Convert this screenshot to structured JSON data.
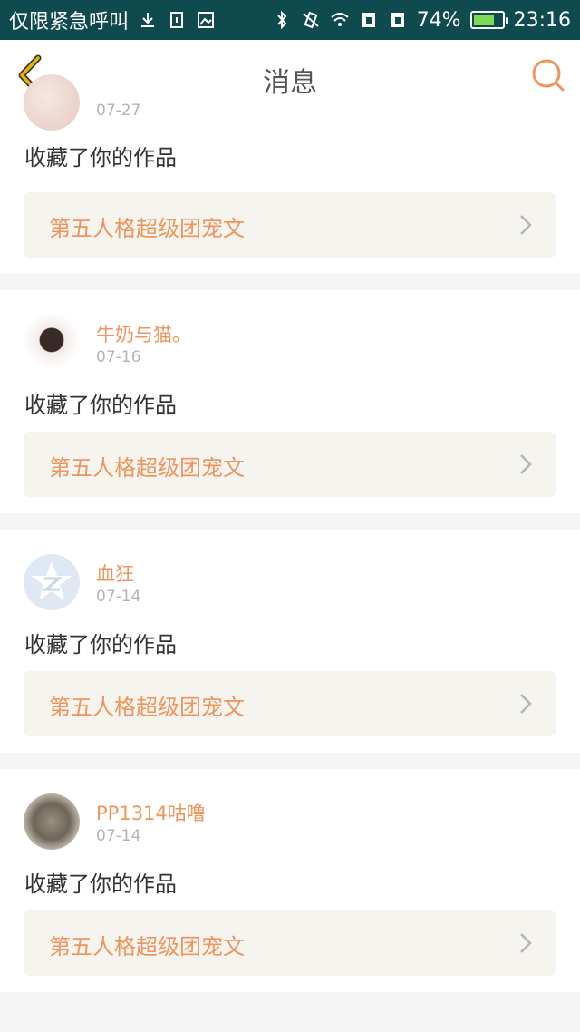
{
  "status_bar": {
    "carrier_text": "仅限紧急呼叫",
    "battery_percent": "74%",
    "battery_level": 0.74,
    "time": "23:16",
    "icons": [
      "download-icon",
      "sim-icon",
      "image-icon",
      "bluetooth-icon",
      "vibrate-icon",
      "wifi-icon",
      "sim1-icon",
      "sim2-icon",
      "battery-icon"
    ]
  },
  "header": {
    "title": "消息",
    "back_icon": "chevron-left-icon",
    "search_icon": "search-icon",
    "accent_color": "#f0955c",
    "back_color": "#e8b400"
  },
  "notifications": [
    {
      "username": "",
      "date": "07-27",
      "action": "收藏了你的作品",
      "work_title": "第五人格超级团宠文"
    },
    {
      "username": "牛奶与猫。",
      "date": "07-16",
      "action": "收藏了你的作品",
      "work_title": "第五人格超级团宠文"
    },
    {
      "username": "血狂",
      "date": "07-14",
      "action": "收藏了你的作品",
      "work_title": "第五人格超级团宠文"
    },
    {
      "username": "PP1314咕噜",
      "date": "07-14",
      "action": "收藏了你的作品",
      "work_title": "第五人格超级团宠文"
    }
  ]
}
